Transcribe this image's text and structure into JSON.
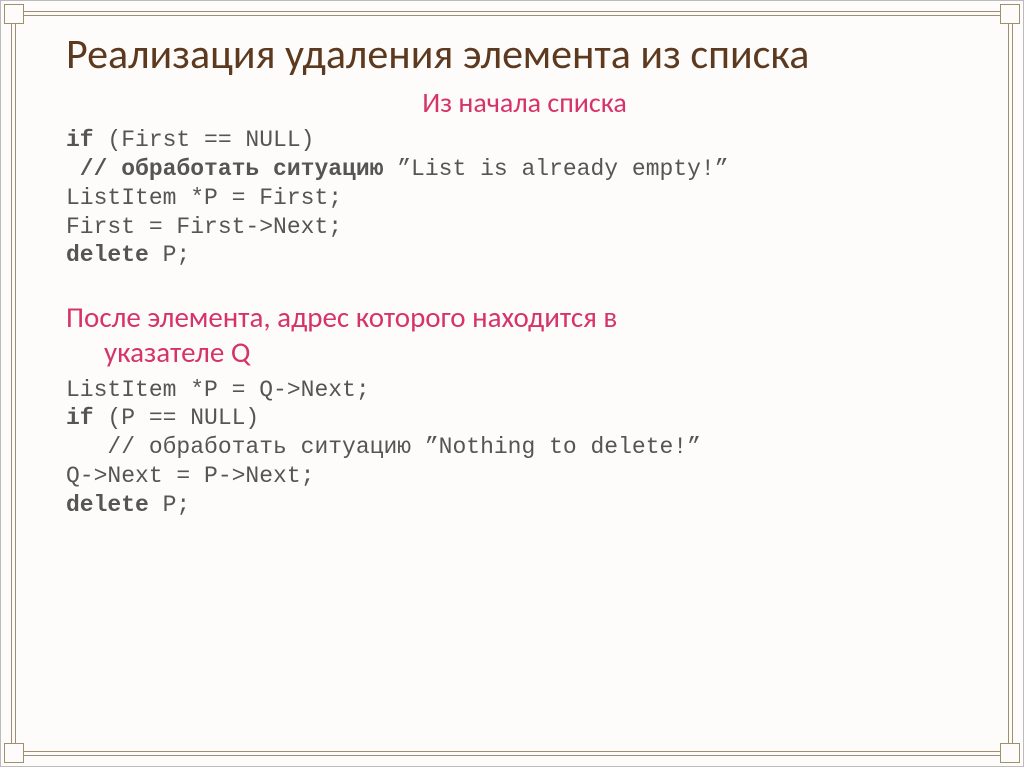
{
  "title": "Реализация удаления элемента из списка",
  "section1": {
    "heading": "Из начала списка",
    "line1_kw": "if",
    "line1_rest": " (First == NULL)",
    "line2_kw": " // обработать ситуацию",
    "line2_rest": " ”List is already empty!”",
    "line3": "ListItem *P = First;",
    "line4": "First = First->Next;",
    "line5_kw": "delete",
    "line5_rest": " P;"
  },
  "section2": {
    "heading_l1": "После элемента, адрес которого находится в",
    "heading_l2": "указателе Q",
    "line1": "ListItem *P = Q->Next;",
    "line2_kw": "if",
    "line2_rest": " (P == NULL)",
    "line3": "   // обработать ситуацию ”Nothing to delete!”",
    "line4": "Q->Next = P->Next;",
    "line5_kw": "delete",
    "line5_rest": " P;"
  }
}
